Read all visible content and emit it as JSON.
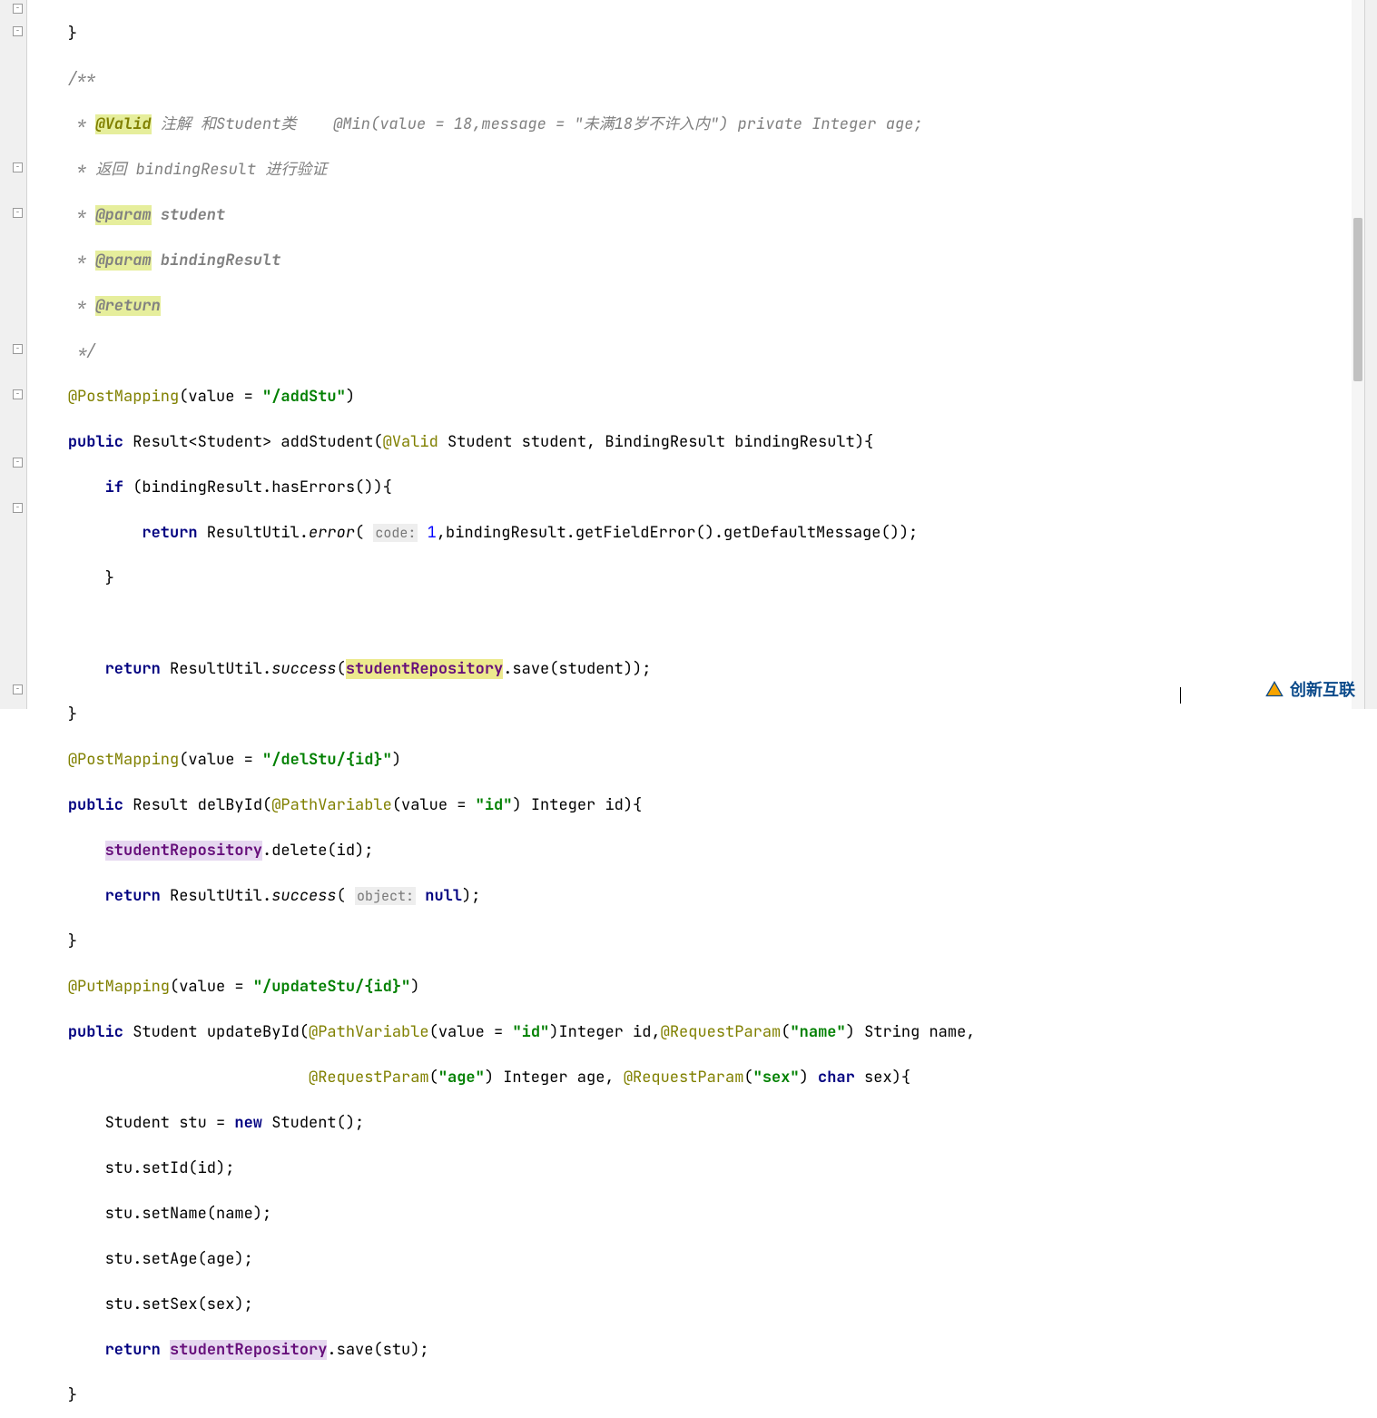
{
  "gutter": {
    "fold_positions": [
      3,
      213,
      388,
      513,
      763
    ]
  },
  "code": {
    "l1": "    }",
    "l2_pre": "    ",
    "l2": "/**",
    "l3_pre": "     * ",
    "l3_tag": "@Valid",
    "l3_rest": " 注解 和Student类    @Min(value = 18,message = \"未满18岁不许入内\") private Integer age;",
    "l4": "     * 返回 bindingResult 进行验证",
    "l5_pre": "     * ",
    "l5_tag": "@param",
    "l5_rest": " ",
    "l5_name": "student",
    "l6_pre": "     * ",
    "l6_tag": "@param",
    "l6_rest": " ",
    "l6_name": "bindingResult",
    "l7_pre": "     * ",
    "l7_tag": "@return",
    "l8": "     */",
    "l9_ann": "@PostMapping",
    "l9_mid": "(value = ",
    "l9_str": "\"/addStu\"",
    "l9_end": ")",
    "l10_kw": "public",
    "l10_a": " Result<Student> addStudent(",
    "l10_ann": "@Valid",
    "l10_b": " Student student, BindingResult bindingResult){",
    "l11_kw": "if",
    "l11_a": " (bindingResult.hasErrors()){",
    "l12_kw": "return",
    "l12_a": " ResultUtil.",
    "l12_m": "error",
    "l12_b": "( ",
    "l12_hint": "code:",
    "l12_num": " 1",
    "l12_c": ",bindingResult.getFieldError().getDefaultMessage());",
    "l13": "        }",
    "l14": "",
    "l15_kw": "return",
    "l15_a": " ResultUtil.",
    "l15_m": "success",
    "l15_b": "(",
    "l15_field": "studentRepository",
    "l15_c": ".save(student));",
    "l16": "    }",
    "l17_ann": "@PostMapping",
    "l17_a": "(value = ",
    "l17_str": "\"/delStu/{id}\"",
    "l17_b": ")",
    "l18_kw": "public",
    "l18_a": " Result delById(",
    "l18_ann": "@PathVariable",
    "l18_b": "(value = ",
    "l18_str": "\"id\"",
    "l18_c": ") Integer id){",
    "l19_field": "studentRepository",
    "l19_a": ".delete(id);",
    "l20_kw": "return",
    "l20_a": " ResultUtil.",
    "l20_m": "success",
    "l20_b": "( ",
    "l20_hint": "object:",
    "l20_null": " null",
    "l20_c": ");",
    "l21": "    }",
    "l22_ann": "@PutMapping",
    "l22_a": "(value = ",
    "l22_str": "\"/updateStu/{id}\"",
    "l22_b": ")",
    "l23_kw": "public",
    "l23_a": " Student updateById(",
    "l23_ann1": "@PathVariable",
    "l23_b": "(value = ",
    "l23_str1": "\"id\"",
    "l23_c": ")Integer id,",
    "l23_ann2": "@RequestParam",
    "l23_d": "(",
    "l23_str2": "\"name\"",
    "l23_e": ") String name,",
    "l24_ann1": "@RequestParam",
    "l24_a": "(",
    "l24_str1": "\"age\"",
    "l24_b": ") Integer age, ",
    "l24_ann2": "@RequestParam",
    "l24_c": "(",
    "l24_str2": "\"sex\"",
    "l24_d": ") ",
    "l24_kw": "char",
    "l24_e": " sex){",
    "l25_a": "        Student stu = ",
    "l25_kw": "new",
    "l25_b": " Student();",
    "l26": "        stu.setId(id);",
    "l27": "        stu.setName(name);",
    "l28": "        stu.setAge(age);",
    "l29": "        stu.setSex(sex);",
    "l30_kw": "return",
    "l30_a": " ",
    "l30_field": "studentRepository",
    "l30_b": ".save(stu);",
    "l31": "    }"
  },
  "watermark": "创新互联"
}
